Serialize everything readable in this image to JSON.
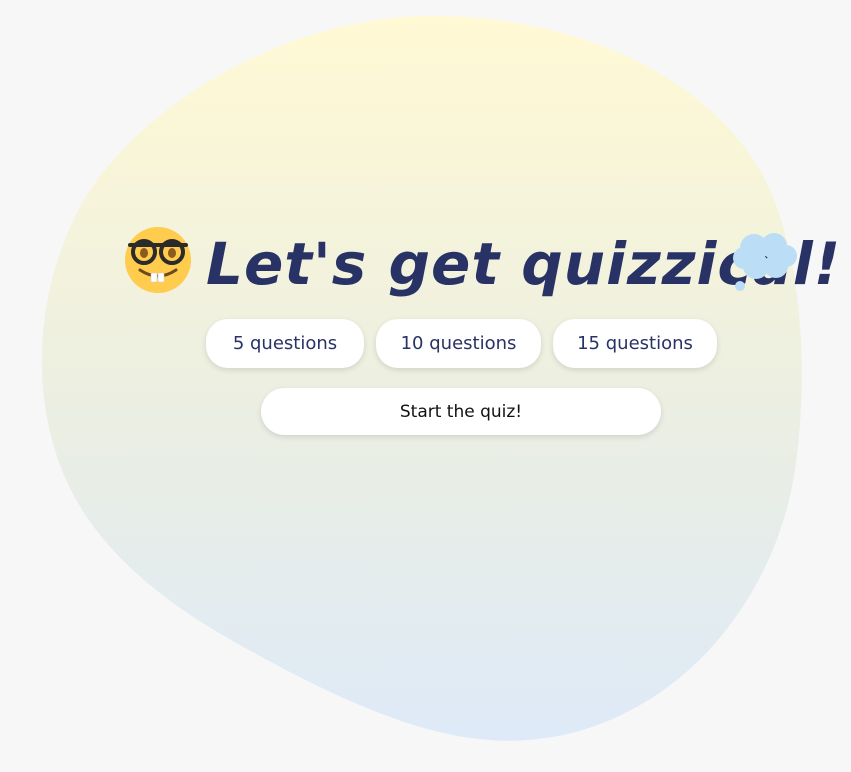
{
  "header": {
    "title": "Let's get quizzical!",
    "left_icon": "nerd-face-emoji",
    "right_icon": "thought-balloon-emoji"
  },
  "options": [
    {
      "label": "5 questions"
    },
    {
      "label": "10 questions"
    },
    {
      "label": "15 questions"
    }
  ],
  "start_button": {
    "label": "Start the quiz!"
  },
  "colors": {
    "background": "#f7f7f7",
    "blob_top": "#fff9d6",
    "blob_bottom": "#deebf7",
    "title": "#283265",
    "button_bg": "#ffffff",
    "nerd_face": "#ffcc4d",
    "thought_balloon": "#bbddf5"
  }
}
